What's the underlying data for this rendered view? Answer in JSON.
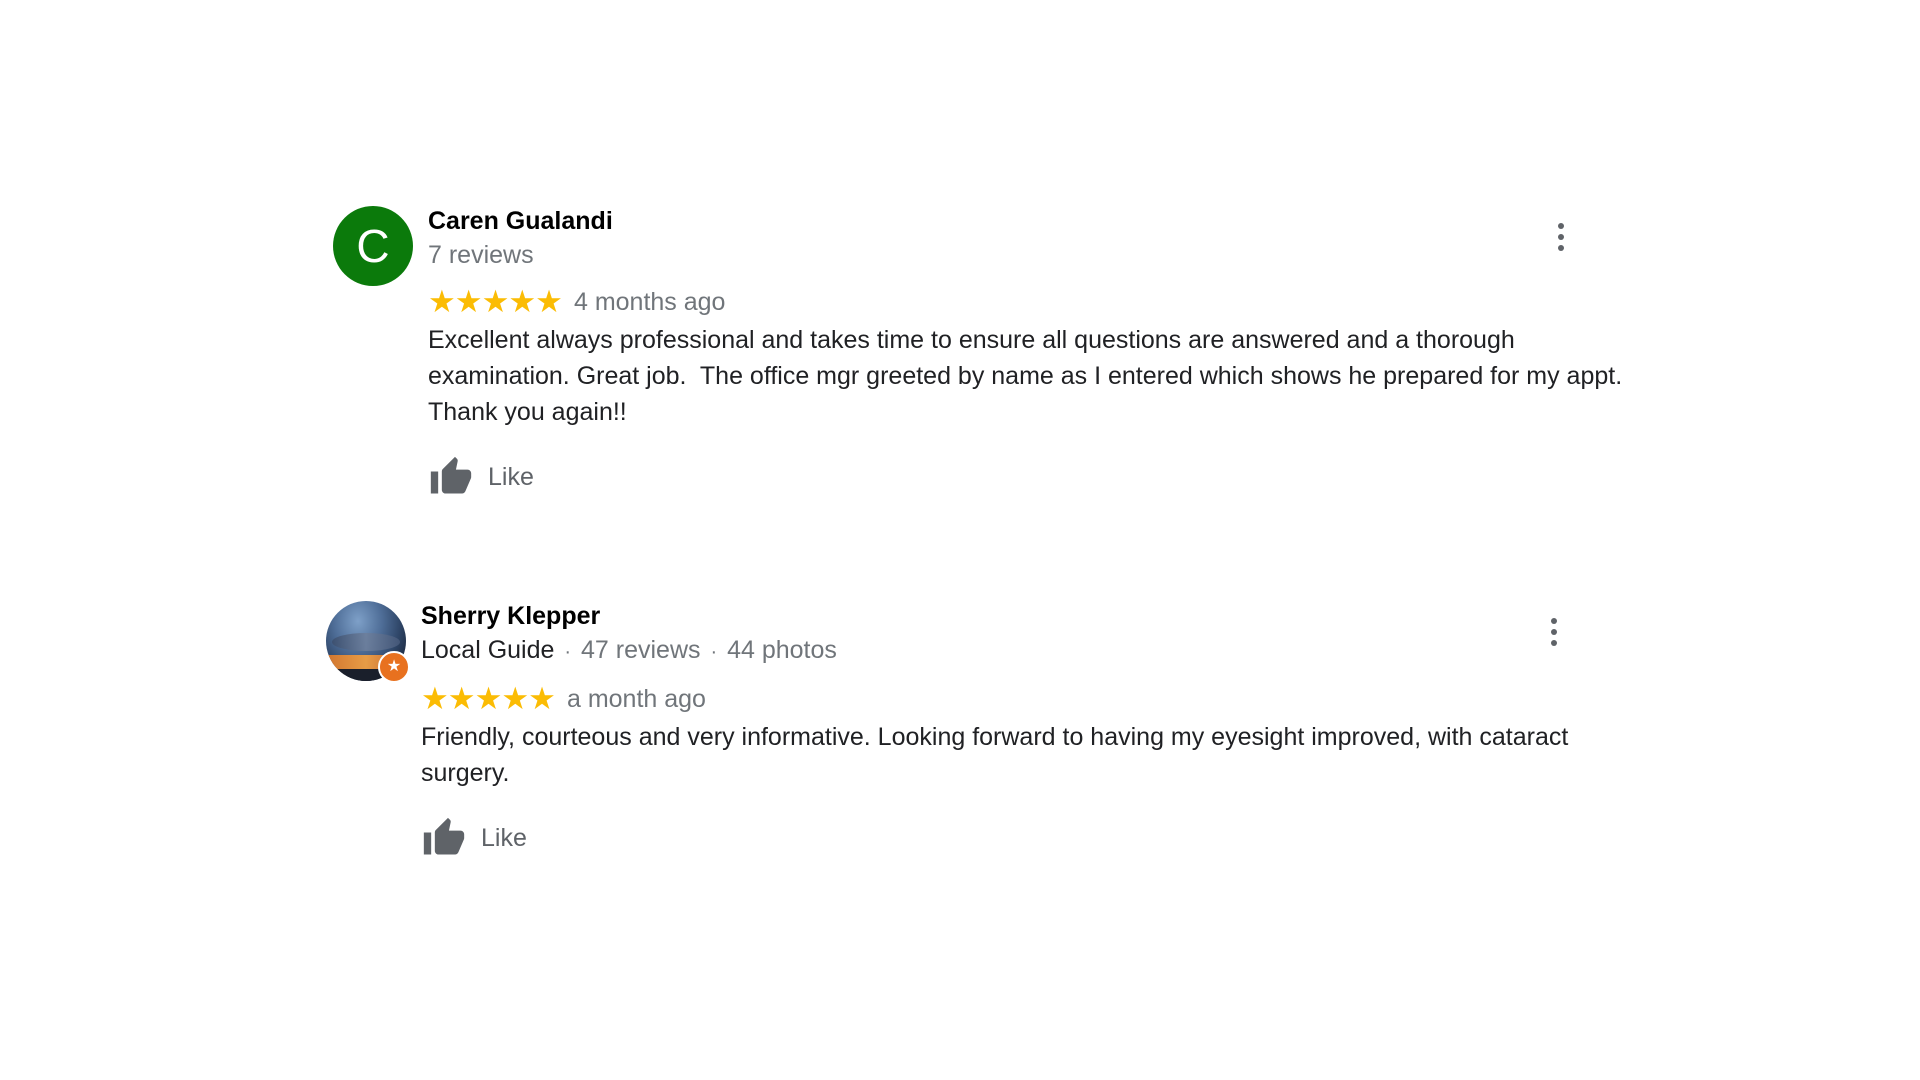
{
  "reviews": [
    {
      "avatar_letter": "C",
      "avatar_color": "#0b7a0b",
      "name": "Caren Gualandi",
      "meta_reviews": "7 reviews",
      "stars": "★★★★★",
      "rating": 5,
      "time": "4 months ago",
      "text": "Excellent always professional and takes time to ensure all questions are answered and a thorough examination. Great job.  The office mgr greeted by name as I entered which shows he prepared for my appt. Thank you again!!",
      "like_label": "Like"
    },
    {
      "avatar_icon": "profile-photo-sunset",
      "badge_icon": "local-guide-star-icon",
      "name": "Sherry Klepper",
      "meta_guide": "Local Guide",
      "meta_sep": "·",
      "meta_reviews": "47 reviews",
      "meta_photos": "44 photos",
      "stars": "★★★★★",
      "rating": 5,
      "time": "a month ago",
      "text": "Friendly, courteous and very informative. Looking forward to having my eyesight improved, with cataract surgery.",
      "like_label": "Like"
    }
  ],
  "colors": {
    "star": "#fbbc04",
    "secondary_text": "#70757a",
    "icon_gray": "#5f6368",
    "badge_orange": "#e8711f"
  }
}
